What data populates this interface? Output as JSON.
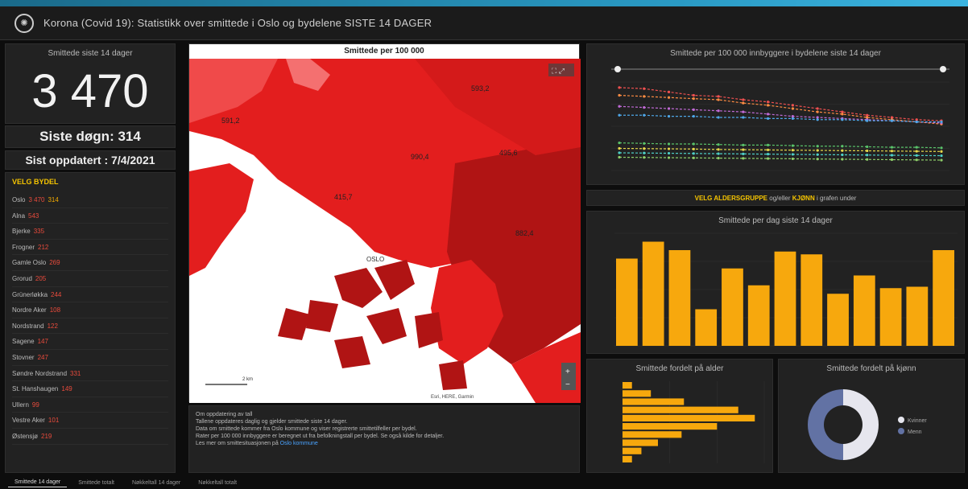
{
  "header": {
    "title": "Korona (Covid 19): Statistikk over smittede i Oslo og bydelene SISTE 14 DAGER",
    "logo_icon": "virus-icon"
  },
  "total": {
    "label": "Smittede siste 14 dager",
    "value": "3 470"
  },
  "last_day": "Siste døgn: 314",
  "updated": "Sist oppdatert : 7/4/2021",
  "district_list": {
    "heading": "VELG BYDEL",
    "items": [
      {
        "name": "Oslo",
        "value": "3 470",
        "extra": "314"
      },
      {
        "name": "Alna",
        "value": "543",
        "extra": ""
      },
      {
        "name": "Bjerke",
        "value": "335",
        "extra": ""
      },
      {
        "name": "Frogner",
        "value": "212",
        "extra": ""
      },
      {
        "name": "Gamle Oslo",
        "value": "269",
        "extra": ""
      },
      {
        "name": "Grorud",
        "value": "205",
        "extra": ""
      },
      {
        "name": "Grünerløkka",
        "value": "244",
        "extra": ""
      },
      {
        "name": "Nordre Aker",
        "value": "108",
        "extra": ""
      },
      {
        "name": "Nordstrand",
        "value": "122",
        "extra": ""
      },
      {
        "name": "Sagene",
        "value": "147",
        "extra": ""
      },
      {
        "name": "Stovner",
        "value": "247",
        "extra": ""
      },
      {
        "name": "Søndre Nordstrand",
        "value": "331",
        "extra": ""
      },
      {
        "name": "St. Hanshaugen",
        "value": "149",
        "extra": ""
      },
      {
        "name": "Ullern",
        "value": "99",
        "extra": ""
      },
      {
        "name": "Vestre Aker",
        "value": "101",
        "extra": ""
      },
      {
        "name": "Østensjø",
        "value": "219",
        "extra": ""
      }
    ]
  },
  "map": {
    "title": "Smittede per 100 000",
    "labels": [
      "593,2",
      "591,2",
      "990,4",
      "495,6",
      "415,7",
      "882,4"
    ],
    "city_label": "OSLO",
    "scale_label": "2 km",
    "attribution": "Esri, HERE, Garmin",
    "colors": {
      "high": "#e31e1e",
      "mid": "#cf1a1a",
      "dark": "#a81212",
      "light": "#f04a4a",
      "land": "#ffffff"
    }
  },
  "info": {
    "lines": [
      "Om oppdatering av tall",
      "Tallene oppdateres daglig og gjelder smittede siste 14 dager.",
      "Data om smittede kommer fra Oslo kommune og viser registrerte smittetilfeller per bydel.",
      "Rater per 100 000 innbyggere er beregnet ut fra befolkningstall per bydel. Se også kilde for detaljer.",
      "Les mer om smittesituasjonen på"
    ],
    "link": "Oslo kommune"
  },
  "line_chart": {
    "title": "Smittede per 100 000 innbyggere i bydelene siste 14 dager"
  },
  "age_selector": {
    "prefix": "VELG ALDERSGRUPPE",
    "middle": "og/eller",
    "highlight": "KJØNN",
    "suffix": "i grafen under"
  },
  "bar_chart": {
    "title": "Smittede per dag siste 14 dager"
  },
  "hbar_chart": {
    "title": "Smittede fordelt på alder"
  },
  "donut_chart": {
    "title": "Smittede fordelt på kjønn",
    "legend": [
      "Kvinner",
      "Menn"
    ],
    "colors": [
      "#e6e6ee",
      "#6272a4"
    ]
  },
  "chart_data": [
    {
      "type": "line",
      "title": "Smittede per 100 000 innbyggere i bydelene siste 14 dager",
      "x": [
        1,
        2,
        3,
        4,
        5,
        6,
        7,
        8,
        9,
        10,
        11,
        12,
        13,
        14
      ],
      "series": [
        {
          "color": "#f05050",
          "values": [
            1150,
            1140,
            1110,
            1080,
            1070,
            1040,
            1020,
            990,
            960,
            930,
            900,
            880,
            860,
            850
          ]
        },
        {
          "color": "#ff8c42",
          "values": [
            1080,
            1070,
            1060,
            1050,
            1040,
            1010,
            990,
            960,
            930,
            910,
            880,
            860,
            840,
            820
          ]
        },
        {
          "color": "#c06ad6",
          "values": [
            980,
            970,
            960,
            950,
            940,
            930,
            910,
            890,
            880,
            870,
            860,
            850,
            840,
            830
          ]
        },
        {
          "color": "#4ea7e8",
          "values": [
            900,
            900,
            890,
            890,
            880,
            880,
            870,
            870,
            860,
            860,
            850,
            850,
            840,
            840
          ]
        },
        {
          "color": "#59c36a",
          "values": [
            650,
            645,
            640,
            640,
            635,
            630,
            630,
            625,
            620,
            620,
            615,
            610,
            610,
            605
          ]
        },
        {
          "color": "#e6d84a",
          "values": [
            600,
            598,
            596,
            594,
            590,
            588,
            586,
            584,
            582,
            580,
            578,
            576,
            574,
            572
          ]
        },
        {
          "color": "#4dd0c8",
          "values": [
            560,
            558,
            556,
            554,
            552,
            550,
            548,
            546,
            544,
            542,
            540,
            538,
            536,
            534
          ]
        },
        {
          "color": "#8fd06a",
          "values": [
            520,
            518,
            516,
            514,
            512,
            510,
            508,
            506,
            504,
            502,
            500,
            498,
            496,
            494
          ]
        }
      ]
    },
    {
      "type": "bar",
      "title": "Smittede per dag siste 14 dager",
      "color": "#f7a80d",
      "values": [
        310,
        370,
        340,
        130,
        275,
        215,
        335,
        325,
        185,
        250,
        205,
        210,
        340
      ]
    },
    {
      "type": "bar",
      "orientation": "horizontal",
      "title": "Smittede fordelt på alder",
      "color": "#f7a80d",
      "values": [
        40,
        120,
        260,
        490,
        560,
        400,
        250,
        150,
        80,
        40
      ]
    },
    {
      "type": "pie",
      "title": "Smittede fordelt på kjønn",
      "categories": [
        "Kvinner",
        "Menn"
      ],
      "values": [
        50,
        50
      ]
    }
  ],
  "footer_tabs": [
    "Smittede 14 dager",
    "Smittede totalt",
    "Nøkkeltall 14 dager",
    "Nøkkeltall totalt"
  ]
}
